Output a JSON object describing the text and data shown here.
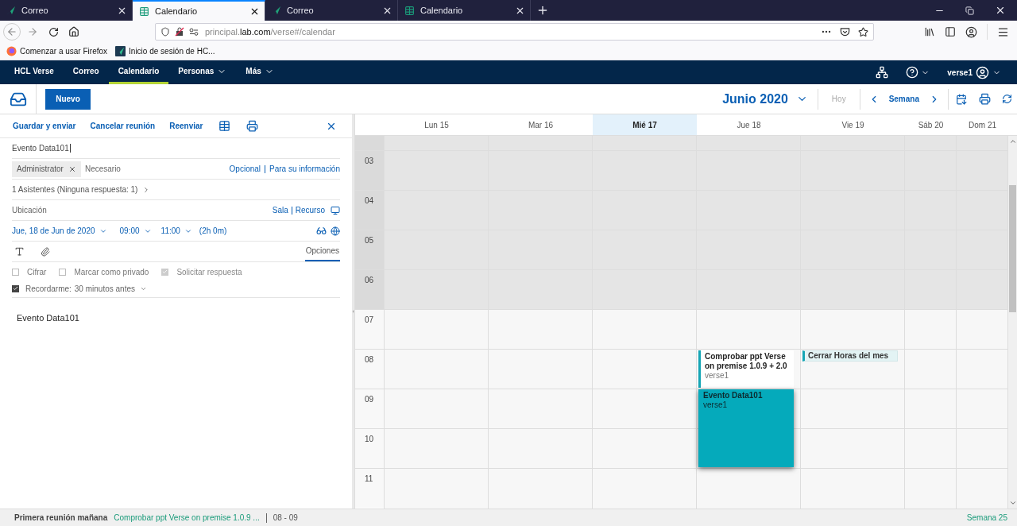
{
  "browser": {
    "tabs": [
      {
        "label": "Correo",
        "kind": "mail",
        "selected": false
      },
      {
        "label": "Calendario",
        "kind": "calendar",
        "selected": true
      },
      {
        "label": "Correo",
        "kind": "mail",
        "selected": false
      },
      {
        "label": "Calendario",
        "kind": "calendar",
        "selected": false
      }
    ],
    "url_parts": [
      {
        "text": "principal.",
        "emphasis": false
      },
      {
        "text": "lab.com",
        "emphasis": true
      },
      {
        "text": "/verse#/calendar",
        "emphasis": false
      }
    ],
    "bookmarks": [
      {
        "label": "Comenzar a usar Firefox",
        "kind": "firefox"
      },
      {
        "label": "Inicio de sesión de HC...",
        "kind": "app"
      }
    ]
  },
  "app_nav": {
    "items": [
      {
        "label": "HCL Verse",
        "selected": false,
        "has_menu": false
      },
      {
        "label": "Correo",
        "selected": false,
        "has_menu": false
      },
      {
        "label": "Calendario",
        "selected": true,
        "has_menu": false
      },
      {
        "label": "Personas",
        "selected": false,
        "has_menu": true
      },
      {
        "label": "Más",
        "selected": false,
        "has_menu": true
      }
    ],
    "user": "verse1"
  },
  "new_button": "Nuevo",
  "calendar_toolbar": {
    "month": "Junio 2020",
    "today": {
      "label": "Hoy",
      "disabled": true
    },
    "view": "Semana"
  },
  "form": {
    "actions": [
      "Guardar y enviar",
      "Cancelar reunión",
      "Reenviar"
    ],
    "subject": "Evento Data101",
    "attendees": [
      {
        "label": "Administrator"
      }
    ],
    "attendee_placeholder": "Necesario",
    "attendee_links": [
      "Opcional",
      "Para su información"
    ],
    "attendees_summary": "1 Asistentes (Ninguna respuesta: 1)",
    "location_placeholder": "Ubicación",
    "room_links": [
      "Sala",
      "Recurso"
    ],
    "date": "Jue, 18 de Jun de 2020",
    "start": "09:00",
    "end": "11:00",
    "duration": "(2h 0m)",
    "options_tab": "Opciones",
    "options": [
      {
        "label": "Cifrar",
        "checked": false,
        "disabled": false
      },
      {
        "label": "Marcar como privado",
        "checked": false,
        "disabled": false
      },
      {
        "label": "Solicitar respuesta",
        "checked": true,
        "disabled": true
      }
    ],
    "reminder": {
      "label": "Recordarme:",
      "value": "30 minutos antes",
      "checked": true
    },
    "body": "Evento Data101"
  },
  "calendar": {
    "days": [
      {
        "label": "Lun 15",
        "selected": false,
        "kind": "weekday"
      },
      {
        "label": "Mar 16",
        "selected": false,
        "kind": "weekday"
      },
      {
        "label": "Mié 17",
        "selected": true,
        "kind": "weekday"
      },
      {
        "label": "Jue 18",
        "selected": false,
        "kind": "weekday"
      },
      {
        "label": "Vie 19",
        "selected": false,
        "kind": "weekday"
      },
      {
        "label": "Sáb 20",
        "selected": false,
        "kind": "weekend"
      },
      {
        "label": "Dom 21",
        "selected": false,
        "kind": "weekend"
      }
    ],
    "hours": [
      {
        "label": "03",
        "off": true,
        "cells": [
          {},
          {},
          {},
          {},
          {},
          {},
          {}
        ]
      },
      {
        "label": "04",
        "off": true,
        "cells": [
          {},
          {},
          {},
          {},
          {},
          {},
          {}
        ]
      },
      {
        "label": "05",
        "off": true,
        "cells": [
          {},
          {},
          {},
          {},
          {},
          {},
          {}
        ]
      },
      {
        "label": "06",
        "off": true,
        "cells": [
          {},
          {},
          {},
          {},
          {},
          {},
          {}
        ]
      },
      {
        "label": "07",
        "off": false,
        "cells": [
          {},
          {},
          {},
          {},
          {},
          {},
          {}
        ]
      },
      {
        "label": "08",
        "off": false,
        "cells": [
          {},
          {},
          {},
          {
            "events": [
              {
                "title": "Comprobar ppt Verse on premise 1.0.9 + 2.0",
                "owner": "verse1",
                "kind": "pending",
                "spans_next_hour": false
              }
            ]
          },
          {
            "events": [
              {
                "title": "Cerrar Horas del mes",
                "kind": "strip"
              }
            ]
          },
          {},
          {}
        ]
      },
      {
        "label": "09",
        "off": false,
        "cells": [
          {},
          {},
          {},
          {
            "events": [
              {
                "title": "Evento Data101",
                "owner": "verse1",
                "kind": "selected",
                "spans_next_hour": true
              }
            ]
          },
          {},
          {},
          {}
        ]
      },
      {
        "label": "10",
        "off": false,
        "cells": [
          {},
          {},
          {},
          {},
          {},
          {},
          {}
        ]
      },
      {
        "label": "11",
        "off": false,
        "cells": [
          {},
          {},
          {},
          {},
          {},
          {},
          {}
        ]
      }
    ]
  },
  "status_bar": {
    "label": "Primera reunión mañana",
    "link": "Comprobar ppt Verse on premise 1.0.9 ...",
    "time": "08 - 09",
    "week": "Semana 25"
  }
}
